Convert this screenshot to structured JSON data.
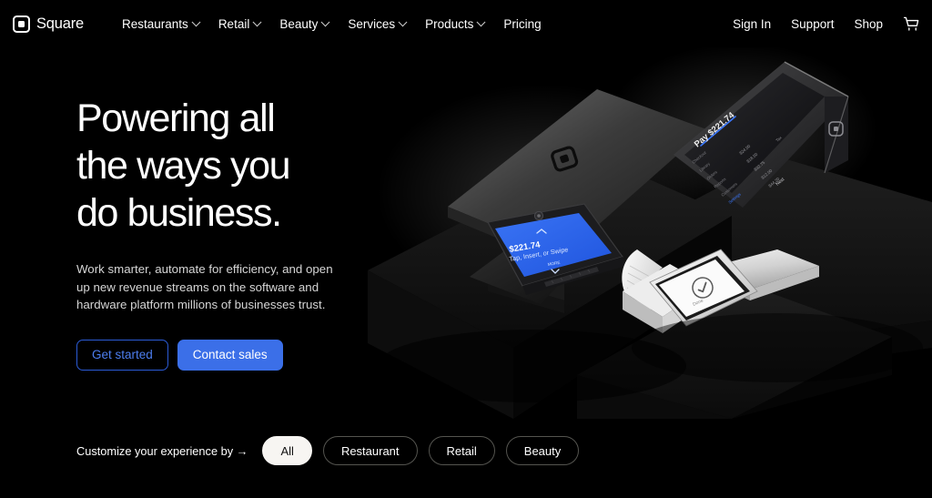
{
  "brand": {
    "name": "Square",
    "logo_icon": "square-logo-icon"
  },
  "nav": {
    "items": [
      {
        "label": "Restaurants",
        "has_dropdown": true
      },
      {
        "label": "Retail",
        "has_dropdown": true
      },
      {
        "label": "Beauty",
        "has_dropdown": true
      },
      {
        "label": "Services",
        "has_dropdown": true
      },
      {
        "label": "Products",
        "has_dropdown": true
      },
      {
        "label": "Pricing",
        "has_dropdown": false
      }
    ],
    "right_links": [
      {
        "label": "Sign In"
      },
      {
        "label": "Support"
      },
      {
        "label": "Shop"
      }
    ],
    "cart_icon": "shopping-cart-icon"
  },
  "hero": {
    "headline_line1": "Powering all",
    "headline_line2": "the ways you",
    "headline_line3": "do business.",
    "subcopy": "Work smarter, automate for efficiency, and open up new revenue streams on the software and hardware platform millions of businesses trust.",
    "primary_cta": "Contact sales",
    "secondary_cta": "Get started"
  },
  "hero_art": {
    "register_screen_title": "Pay $221.74",
    "register_next_label": "Next",
    "terminal_amount": "$221.74",
    "terminal_prompt": "Tap, Insert, or Swipe",
    "handheld_status_icon": "check-circle-icon",
    "handheld_status_label": "Done"
  },
  "customize": {
    "label": "Customize your experience by →",
    "options": [
      {
        "label": "All",
        "active": true
      },
      {
        "label": "Restaurant",
        "active": false
      },
      {
        "label": "Retail",
        "active": false
      },
      {
        "label": "Beauty",
        "active": false
      }
    ]
  },
  "colors": {
    "background": "#000000",
    "accent_blue": "#3b6fe8",
    "outline_blue": "#2b5bd6",
    "text_primary": "#ffffff",
    "text_muted": "#d6d6d6",
    "pill_active_bg": "#f7f5f2",
    "terminal_screen_blue": "#2f6bf0"
  }
}
